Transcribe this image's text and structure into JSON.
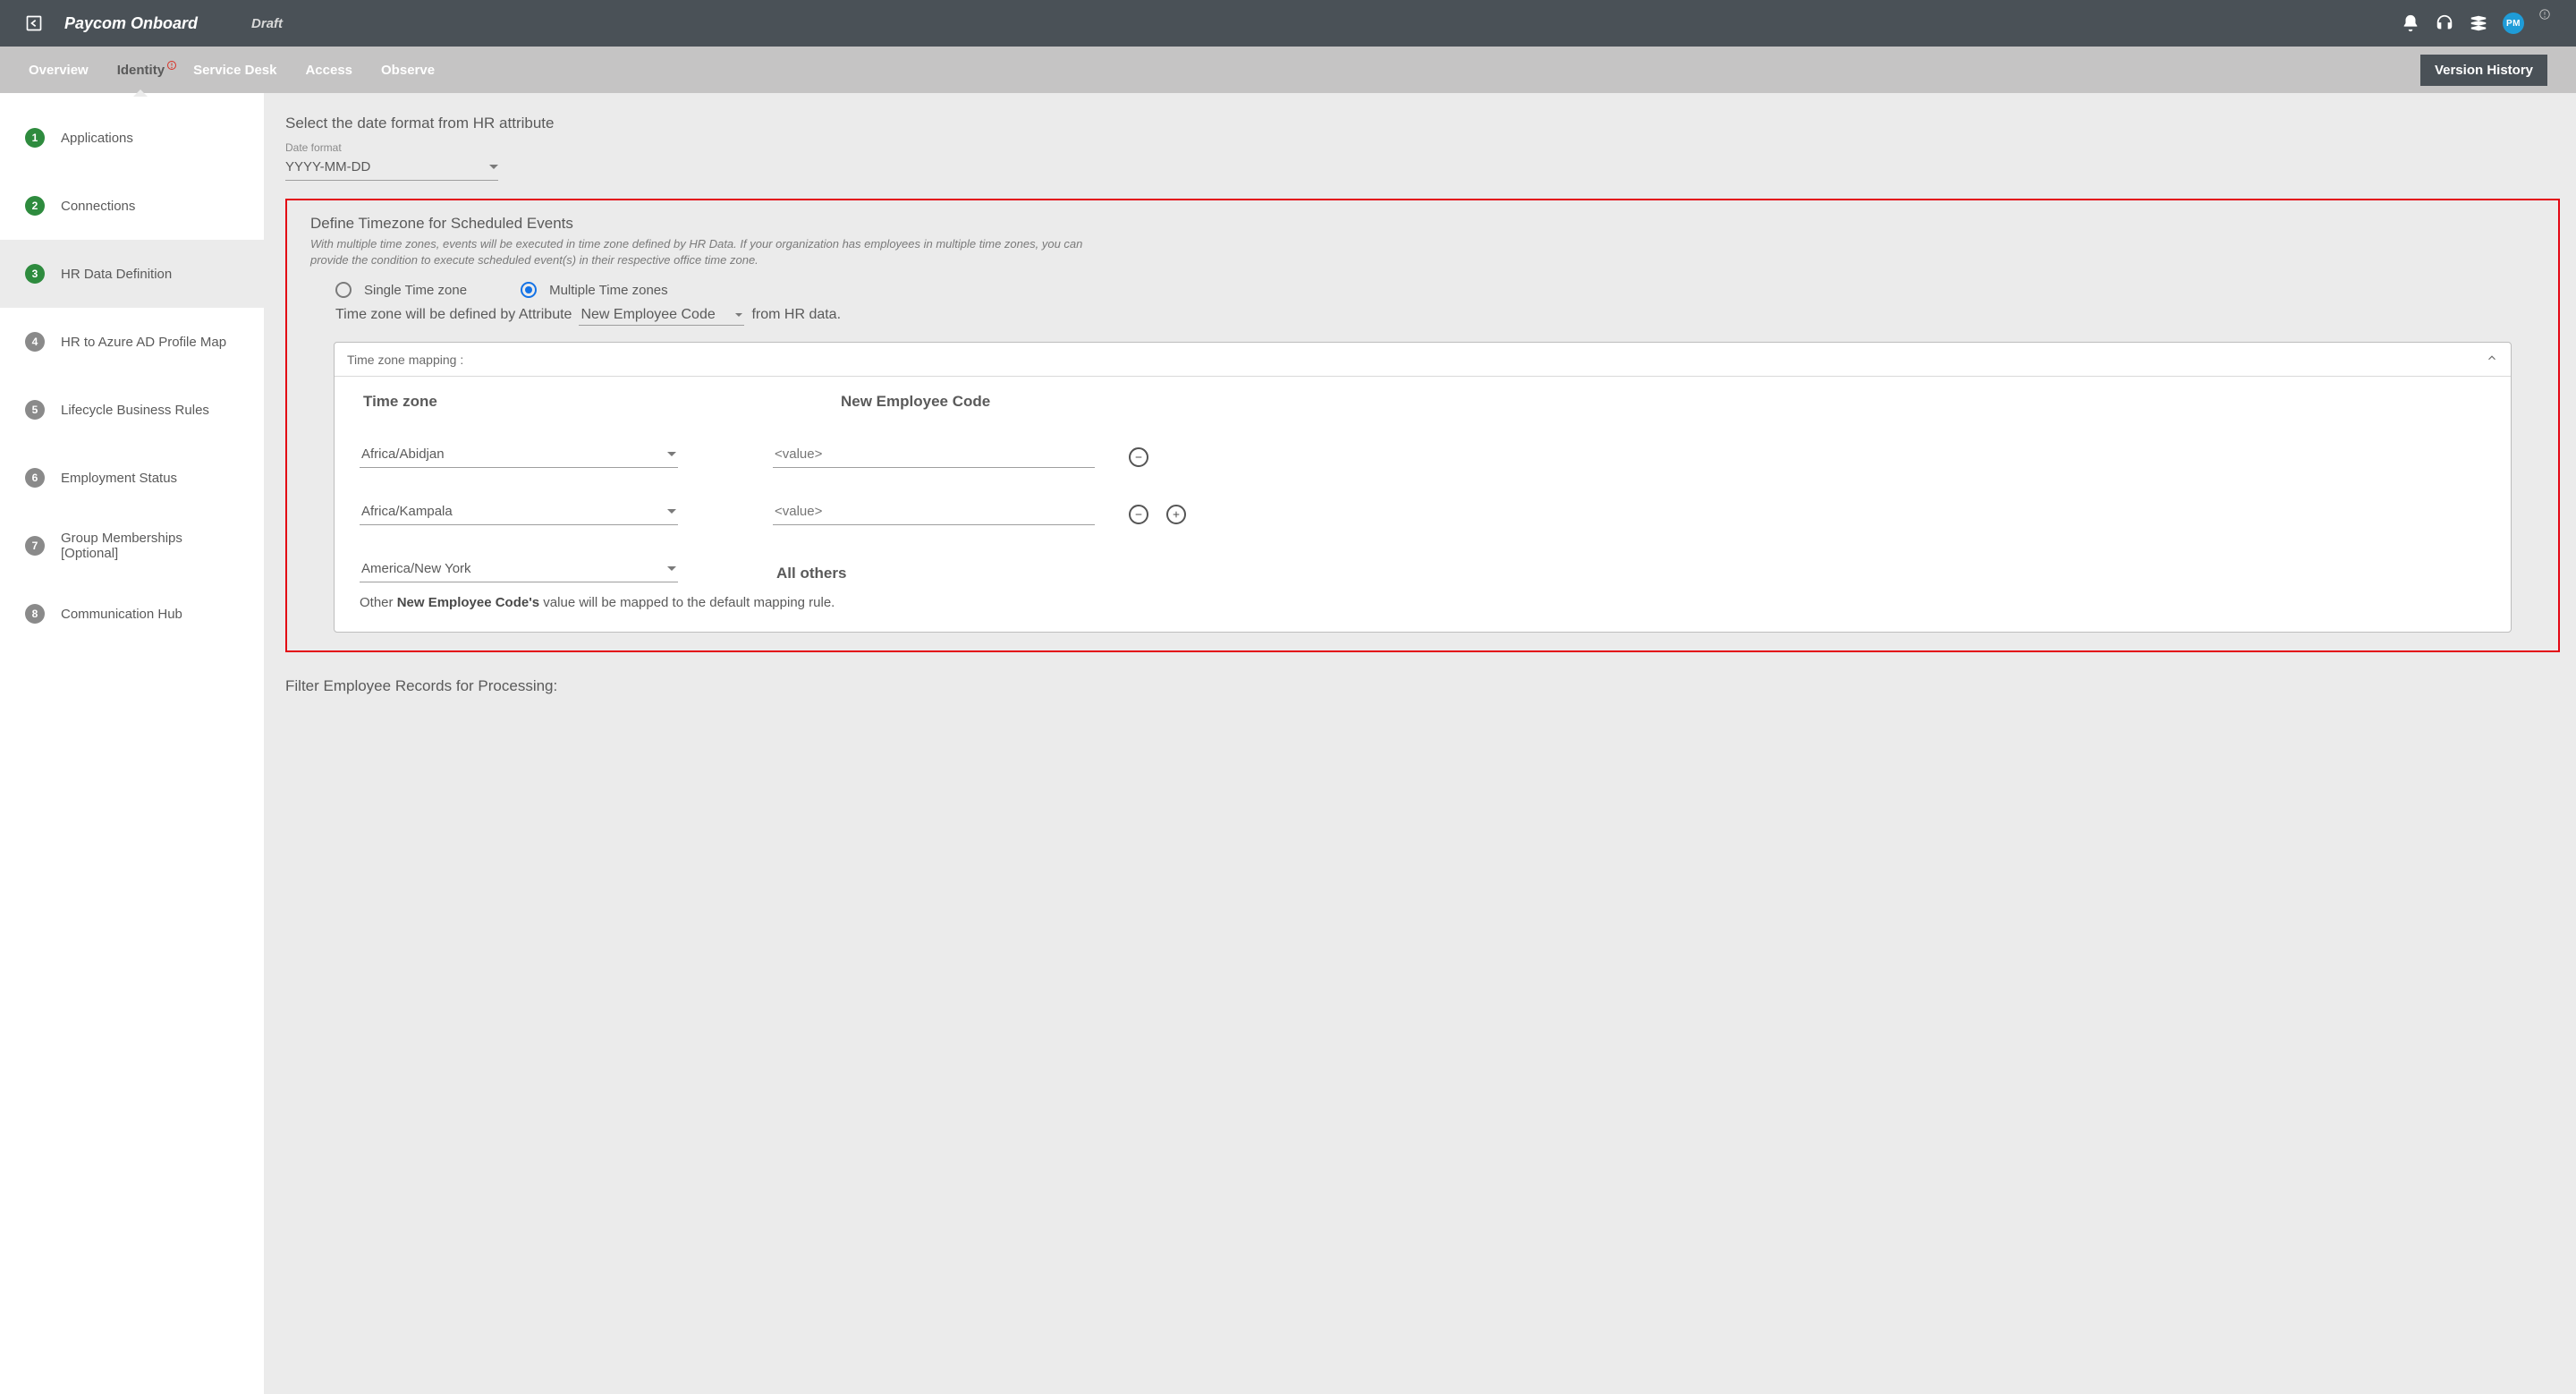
{
  "header": {
    "title": "Paycom Onboard",
    "status": "Draft",
    "avatar_initials": "PM"
  },
  "tabs": {
    "overview": "Overview",
    "identity": "Identity",
    "servicedesk": "Service Desk",
    "access": "Access",
    "observe": "Observe",
    "version_history": "Version History"
  },
  "sidebar": {
    "items": [
      {
        "n": "1",
        "label": "Applications",
        "state": "done"
      },
      {
        "n": "2",
        "label": "Connections",
        "state": "done"
      },
      {
        "n": "3",
        "label": "HR Data Definition",
        "state": "done",
        "active": true
      },
      {
        "n": "4",
        "label": "HR to Azure AD Profile Map",
        "state": "pending"
      },
      {
        "n": "5",
        "label": "Lifecycle Business Rules",
        "state": "pending"
      },
      {
        "n": "6",
        "label": "Employment Status",
        "state": "pending"
      },
      {
        "n": "7",
        "label": "Group Memberships [Optional]",
        "state": "pending"
      },
      {
        "n": "8",
        "label": "Communication Hub",
        "state": "pending"
      }
    ]
  },
  "main": {
    "dateformat_section_title": "Select the date format from HR attribute",
    "dateformat_label": "Date format",
    "dateformat_value": "YYYY-MM-DD",
    "tz_section_title": "Define Timezone for Scheduled Events",
    "tz_section_desc": "With multiple time zones, events will be executed in time zone defined by HR Data. If your organization has employees in multiple time zones, you can provide the condition to execute scheduled event(s) in their respective office time zone.",
    "radio_single": "Single Time zone",
    "radio_multiple": "Multiple Time zones",
    "attr_sentence_pre": "Time zone will be defined by Attribute",
    "attr_sentence_value": "New Employee Code",
    "attr_sentence_post": "from HR data.",
    "mapping_header": "Time zone mapping :",
    "col_tz": "Time zone",
    "col_val": "New Employee Code",
    "value_placeholder": "<value>",
    "rows": [
      {
        "tz": "Africa/Abidjan",
        "has_remove": true,
        "has_add": false
      },
      {
        "tz": "Africa/Kampala",
        "has_remove": true,
        "has_add": true
      }
    ],
    "default_tz": "America/New York",
    "all_others_label": "All others",
    "footnote_pre": "Other ",
    "footnote_bold": "New Employee Code's",
    "footnote_post": " value will be mapped to the default mapping rule.",
    "filter_section_title": "Filter Employee Records for Processing:"
  }
}
